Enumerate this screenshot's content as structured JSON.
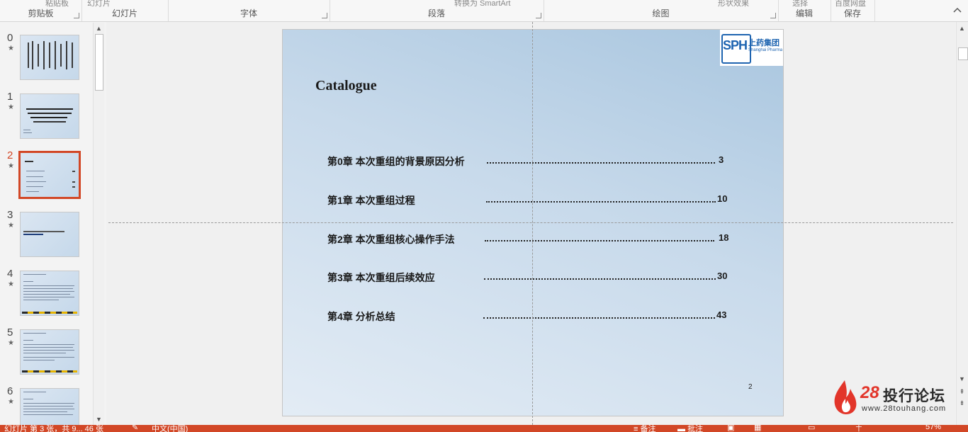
{
  "ribbon": {
    "groups": [
      {
        "label": "剪贴板",
        "cut": "粘贴板"
      },
      {
        "label": "幻灯片",
        "cut": "幻灯片"
      },
      {
        "label": "字体",
        "cut": ""
      },
      {
        "label": "段落",
        "cut": "转换为 SmartArt"
      },
      {
        "label": "绘图",
        "cut": "形状效果"
      },
      {
        "label": "编辑",
        "cut": "选择"
      },
      {
        "label": "保存",
        "cut": "百度网盘"
      }
    ]
  },
  "thumbnails": [
    {
      "num": "0",
      "star": "★"
    },
    {
      "num": "1",
      "star": "★"
    },
    {
      "num": "2",
      "star": "★",
      "active": true
    },
    {
      "num": "3",
      "star": "★"
    },
    {
      "num": "4",
      "star": "★"
    },
    {
      "num": "5",
      "star": "★"
    },
    {
      "num": "6",
      "star": "★"
    }
  ],
  "slide": {
    "logo_mark": "SPH",
    "logo_cn": "上药集团",
    "logo_en": "Shanghai Pharma",
    "title": "Catalogue",
    "toc": [
      {
        "label": "第0章 本次重组的背景原因分析",
        "page": "3"
      },
      {
        "label": "第1章 本次重组过程",
        "page": "10"
      },
      {
        "label": "第2章 本次重组核心操作手法",
        "page": "18"
      },
      {
        "label": "第3章 本次重组后续效应",
        "page": "30"
      },
      {
        "label": "第4章 分析总结",
        "page": "43"
      }
    ],
    "number": "2"
  },
  "watermark": {
    "num": "28",
    "text": "投行论坛",
    "url": "www.28touhang.com"
  },
  "status": {
    "slide_info": "幻灯片 第 3 张，共 9... 46 张",
    "language": "中文(中国)",
    "notes": "备注",
    "comments": "批注",
    "zoom": "57%"
  },
  "colors": {
    "accent": "#d24726",
    "logo_blue": "#1e64b0",
    "watermark_red": "#e2352a"
  }
}
